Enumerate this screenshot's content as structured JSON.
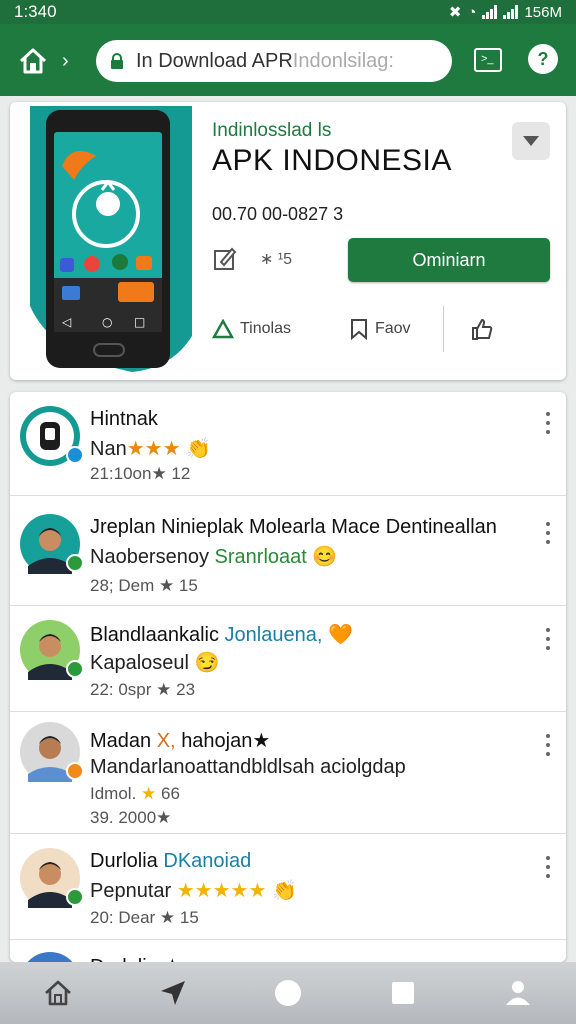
{
  "status_bar": {
    "time": "1:340",
    "battery": "156M"
  },
  "toolbar": {
    "url": "In Download APR",
    "url_faded": " Indonlsilag:"
  },
  "app": {
    "publisher": "Indinlosslad ls",
    "title": "APK  INDONESIA",
    "version": "00.70 00-0827 3",
    "meta_size": "∗ ¹5",
    "install_label": "Ominiarn",
    "action_share": "Tinolas",
    "action_fav": "Faov"
  },
  "list": {
    "items": [
      {
        "title": "Hintnak",
        "sub_pre": "Nan",
        "sub_stars": "★★★",
        "sub_emoji": "👏",
        "meta": "21:10on★ 12"
      },
      {
        "title": "Jreplan Ninieplak Molearla Mace Dentineallan",
        "sub_pre": "Naobersenoy",
        "sub_hl": "Sranrloaat",
        "sub_emoji": "😊",
        "meta": "28; Dem ★ 15"
      },
      {
        "title": "Blandlaankalic",
        "title_hl": "Jonlauena,",
        "title_emoji": "🧡",
        "sub_pre": "Kapaloseul",
        "sub_emoji": "😏",
        "meta": "22: 0spr ★ 23"
      },
      {
        "title": "Madan",
        "title_hl": "X,",
        "title_post": "hahojan★",
        "sub_pre": "Mandarlanoattandbldlsah aciolgdap",
        "meta": "Idmol.",
        "meta_stars": "★",
        "meta_post": " 66",
        "meta2": "39. 2000★"
      },
      {
        "title": "Durlolia",
        "title_hl": "DKanoiad",
        "sub_pre": "Pepnutar",
        "sub_stars": "★★★★★",
        "sub_emoji": "👏",
        "meta": "20: Dear ★ 15"
      },
      {
        "title": "Durlolia ★"
      }
    ]
  },
  "colors": {
    "primary": "#1e7a3f",
    "teal": "#149a92",
    "star": "#e98a10"
  }
}
